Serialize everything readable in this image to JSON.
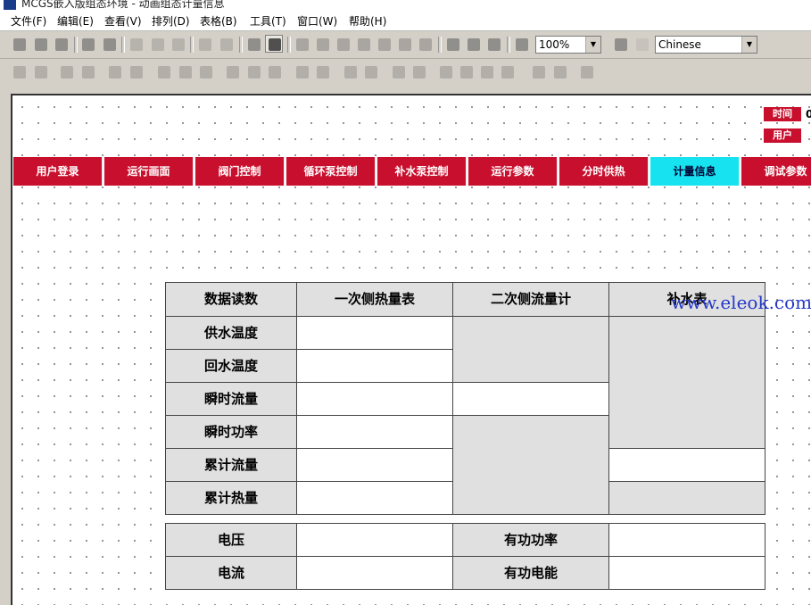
{
  "window": {
    "title": "MCGS嵌入版组态环境 - 动画组态计量信息"
  },
  "menu": [
    "文件(F)",
    "编辑(E)",
    "查看(V)",
    "排列(D)",
    "表格(B)",
    "工具(T)",
    "窗口(W)",
    "帮助(H)"
  ],
  "toolbar": {
    "zoom": "100%",
    "language": "Chinese"
  },
  "header": {
    "time_label": "时间",
    "time_value": "0",
    "user_label": "用户"
  },
  "tabs": [
    {
      "label": "用户登录",
      "active": false
    },
    {
      "label": "运行画面",
      "active": false
    },
    {
      "label": "阀门控制",
      "active": false
    },
    {
      "label": "循环泵控制",
      "active": false
    },
    {
      "label": "补水泵控制",
      "active": false
    },
    {
      "label": "运行参数",
      "active": false
    },
    {
      "label": "分时供热",
      "active": false
    },
    {
      "label": "计量信息",
      "active": true
    },
    {
      "label": "调试参数",
      "active": false
    }
  ],
  "meter_table": {
    "headers": [
      "数据读数",
      "一次侧热量表",
      "二次侧流量计",
      "补水表"
    ],
    "rows": [
      "供水温度",
      "回水温度",
      "瞬时流量",
      "瞬时功率",
      "累计流量",
      "累计热量"
    ]
  },
  "power_table": {
    "voltage_label": "电压",
    "current_label": "电流",
    "active_power_label": "有功功率",
    "active_energy_label": "有功电能"
  },
  "watermark": "www.eleok.com",
  "colors": {
    "tab_red": "#c8102e",
    "tab_active": "#17e3f0",
    "cell_gray": "#e0e0e0"
  }
}
